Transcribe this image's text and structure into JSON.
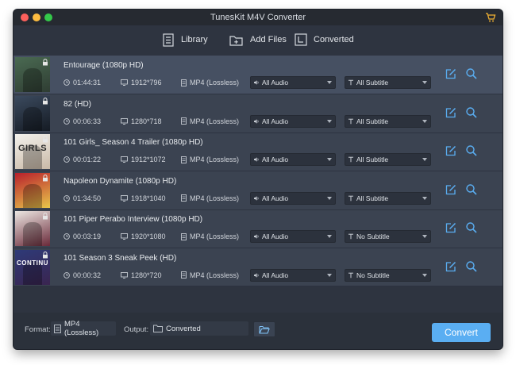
{
  "window": {
    "title": "TunesKit M4V Converter",
    "accent_color": "#5aaef2",
    "icons": [
      "close-icon",
      "minimize-icon",
      "zoom-icon",
      "cart-icon"
    ]
  },
  "toolbar": {
    "library_label": "Library",
    "add_files_label": "Add Files",
    "converted_label": "Converted"
  },
  "items": [
    {
      "title": "Entourage (1080p HD)",
      "duration": "01:44:31",
      "resolution": "1912*796",
      "format": "MP4 (Lossless)",
      "audio": "All Audio",
      "subtitle": "All Subtitle",
      "thumb_colors": [
        "#4a6a52",
        "#2f3d33"
      ]
    },
    {
      "title": "82 (HD)",
      "duration": "00:06:33",
      "resolution": "1280*718",
      "format": "MP4 (Lossless)",
      "audio": "All Audio",
      "subtitle": "All Subtitle",
      "thumb_colors": [
        "#3b4a5e",
        "#151b24"
      ]
    },
    {
      "title": "101 Girls_ Season 4 Trailer (1080p HD)",
      "duration": "00:01:22",
      "resolution": "1912*1072",
      "format": "MP4 (Lossless)",
      "audio": "All Audio",
      "subtitle": "All Subtitle",
      "thumb_text": "GIRLS",
      "thumb_colors": [
        "#f3f1ec",
        "#c9b9a7"
      ]
    },
    {
      "title": "Napoleon Dynamite (1080p HD)",
      "duration": "01:34:50",
      "resolution": "1918*1040",
      "format": "MP4 (Lossless)",
      "audio": "All Audio",
      "subtitle": "All Subtitle",
      "thumb_colors": [
        "#b81f2c",
        "#e8c64a"
      ]
    },
    {
      "title": "101 Piper Perabo Interview (1080p HD)",
      "duration": "00:03:19",
      "resolution": "1920*1080",
      "format": "MP4 (Lossless)",
      "audio": "All Audio",
      "subtitle": "No Subtitle",
      "thumb_colors": [
        "#ece7e2",
        "#6a2a3a"
      ]
    },
    {
      "title": "101 Season 3 Sneak Peek (HD)",
      "duration": "00:00:32",
      "resolution": "1280*720",
      "format": "MP4 (Lossless)",
      "audio": "All Audio",
      "subtitle": "No Subtitle",
      "thumb_text": "CONTINU",
      "thumb_colors": [
        "#2e3a78",
        "#3a2550"
      ]
    }
  ],
  "footer": {
    "format_label": "Format:",
    "format_value": "MP4 (Lossless)",
    "output_label": "Output:",
    "output_value": "Converted",
    "convert_label": "Convert"
  }
}
